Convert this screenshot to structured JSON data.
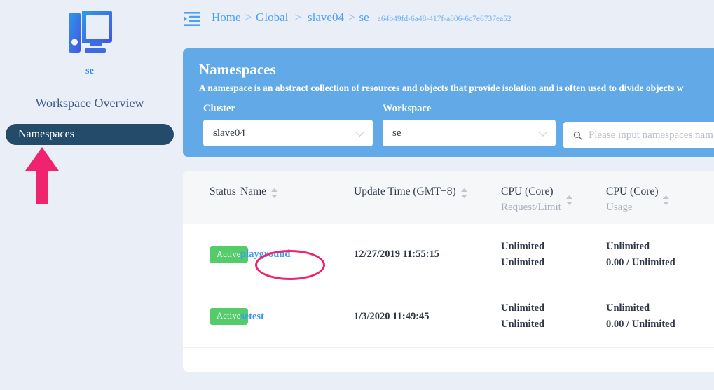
{
  "sidebar": {
    "logo_icon": "desktop-computer-icon",
    "workspace_name": "se",
    "items": [
      {
        "label": "Workspace Overview",
        "active": false
      },
      {
        "label": "Namespaces",
        "active": true
      }
    ]
  },
  "topbar": {
    "fold_icon": "menu-fold-icon",
    "breadcrumb": {
      "items": [
        {
          "label": "Home"
        },
        {
          "label": "Global"
        },
        {
          "label": "slave04"
        },
        {
          "label": "se"
        }
      ],
      "separator": ">",
      "uuid": "a64b49fd-6a48-417f-a806-6c7e6737ea52"
    }
  },
  "banner": {
    "title": "Namespaces",
    "description": "A namespace is an abstract collection of resources and objects that provide isolation and is often used to divide objects w",
    "cluster": {
      "label": "Cluster",
      "value": "slave04",
      "chevron_icon": "chevron-down-icon"
    },
    "workspace": {
      "label": "Workspace",
      "value": "se",
      "chevron_icon": "chevron-down-icon"
    },
    "search": {
      "icon": "search-icon",
      "placeholder": "Please input namespaces nam",
      "value": ""
    }
  },
  "table": {
    "columns": [
      {
        "key": "status",
        "label": "Status",
        "sub": "",
        "sortable": false
      },
      {
        "key": "name",
        "label": "Name",
        "sub": "",
        "sortable": true
      },
      {
        "key": "time",
        "label": "Update Time (GMT+8)",
        "sub": "",
        "sortable": true
      },
      {
        "key": "request",
        "label": "CPU (Core)",
        "sub": "Request/Limit",
        "sortable": true
      },
      {
        "key": "usage",
        "label": "CPU (Core)",
        "sub": "Usage",
        "sortable": true
      }
    ],
    "rows": [
      {
        "status": "Active",
        "name": "playground",
        "time": "12/27/2019 11:55:15",
        "request_line1": "Unlimited",
        "request_line2": "Unlimited",
        "usage_line1": "Unlimited",
        "usage_line2": "0.00 / Unlimited",
        "highlighted": true
      },
      {
        "status": "Active",
        "name": "setest",
        "time": "1/3/2020 11:49:45",
        "request_line1": "Unlimited",
        "request_line2": "Unlimited",
        "usage_line1": "Unlimited",
        "usage_line2": "0.00 / Unlimited",
        "highlighted": false
      }
    ]
  },
  "annotations": {
    "arrow": {
      "name": "pink-up-arrow",
      "color": "#f0246e",
      "points_to": "Namespaces"
    },
    "ellipse": {
      "name": "pink-ellipse-highlight",
      "color": "#f0246e",
      "surrounds": "playground"
    }
  },
  "colors": {
    "page_bg": "#eaeff7",
    "banner_bg": "#62a9e8",
    "nav_active_bg": "#254b6b",
    "link_blue": "#3c9bf0",
    "badge_green": "#55cc6a",
    "annotation_pink": "#f0246e"
  }
}
